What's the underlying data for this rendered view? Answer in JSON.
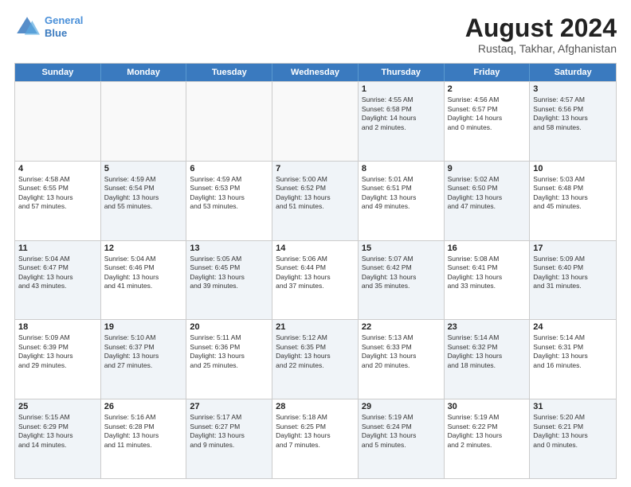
{
  "logo": {
    "line1": "General",
    "line2": "Blue"
  },
  "header": {
    "month_year": "August 2024",
    "location": "Rustaq, Takhar, Afghanistan"
  },
  "weekdays": [
    "Sunday",
    "Monday",
    "Tuesday",
    "Wednesday",
    "Thursday",
    "Friday",
    "Saturday"
  ],
  "weeks": [
    [
      {
        "day": "",
        "info": "",
        "empty": true
      },
      {
        "day": "",
        "info": "",
        "empty": true
      },
      {
        "day": "",
        "info": "",
        "empty": true
      },
      {
        "day": "",
        "info": "",
        "empty": true
      },
      {
        "day": "1",
        "info": "Sunrise: 4:55 AM\nSunset: 6:58 PM\nDaylight: 14 hours\nand 2 minutes.",
        "empty": false
      },
      {
        "day": "2",
        "info": "Sunrise: 4:56 AM\nSunset: 6:57 PM\nDaylight: 14 hours\nand 0 minutes.",
        "empty": false
      },
      {
        "day": "3",
        "info": "Sunrise: 4:57 AM\nSunset: 6:56 PM\nDaylight: 13 hours\nand 58 minutes.",
        "empty": false
      }
    ],
    [
      {
        "day": "4",
        "info": "Sunrise: 4:58 AM\nSunset: 6:55 PM\nDaylight: 13 hours\nand 57 minutes.",
        "empty": false
      },
      {
        "day": "5",
        "info": "Sunrise: 4:59 AM\nSunset: 6:54 PM\nDaylight: 13 hours\nand 55 minutes.",
        "empty": false
      },
      {
        "day": "6",
        "info": "Sunrise: 4:59 AM\nSunset: 6:53 PM\nDaylight: 13 hours\nand 53 minutes.",
        "empty": false
      },
      {
        "day": "7",
        "info": "Sunrise: 5:00 AM\nSunset: 6:52 PM\nDaylight: 13 hours\nand 51 minutes.",
        "empty": false
      },
      {
        "day": "8",
        "info": "Sunrise: 5:01 AM\nSunset: 6:51 PM\nDaylight: 13 hours\nand 49 minutes.",
        "empty": false
      },
      {
        "day": "9",
        "info": "Sunrise: 5:02 AM\nSunset: 6:50 PM\nDaylight: 13 hours\nand 47 minutes.",
        "empty": false
      },
      {
        "day": "10",
        "info": "Sunrise: 5:03 AM\nSunset: 6:48 PM\nDaylight: 13 hours\nand 45 minutes.",
        "empty": false
      }
    ],
    [
      {
        "day": "11",
        "info": "Sunrise: 5:04 AM\nSunset: 6:47 PM\nDaylight: 13 hours\nand 43 minutes.",
        "empty": false
      },
      {
        "day": "12",
        "info": "Sunrise: 5:04 AM\nSunset: 6:46 PM\nDaylight: 13 hours\nand 41 minutes.",
        "empty": false
      },
      {
        "day": "13",
        "info": "Sunrise: 5:05 AM\nSunset: 6:45 PM\nDaylight: 13 hours\nand 39 minutes.",
        "empty": false
      },
      {
        "day": "14",
        "info": "Sunrise: 5:06 AM\nSunset: 6:44 PM\nDaylight: 13 hours\nand 37 minutes.",
        "empty": false
      },
      {
        "day": "15",
        "info": "Sunrise: 5:07 AM\nSunset: 6:42 PM\nDaylight: 13 hours\nand 35 minutes.",
        "empty": false
      },
      {
        "day": "16",
        "info": "Sunrise: 5:08 AM\nSunset: 6:41 PM\nDaylight: 13 hours\nand 33 minutes.",
        "empty": false
      },
      {
        "day": "17",
        "info": "Sunrise: 5:09 AM\nSunset: 6:40 PM\nDaylight: 13 hours\nand 31 minutes.",
        "empty": false
      }
    ],
    [
      {
        "day": "18",
        "info": "Sunrise: 5:09 AM\nSunset: 6:39 PM\nDaylight: 13 hours\nand 29 minutes.",
        "empty": false
      },
      {
        "day": "19",
        "info": "Sunrise: 5:10 AM\nSunset: 6:37 PM\nDaylight: 13 hours\nand 27 minutes.",
        "empty": false
      },
      {
        "day": "20",
        "info": "Sunrise: 5:11 AM\nSunset: 6:36 PM\nDaylight: 13 hours\nand 25 minutes.",
        "empty": false
      },
      {
        "day": "21",
        "info": "Sunrise: 5:12 AM\nSunset: 6:35 PM\nDaylight: 13 hours\nand 22 minutes.",
        "empty": false
      },
      {
        "day": "22",
        "info": "Sunrise: 5:13 AM\nSunset: 6:33 PM\nDaylight: 13 hours\nand 20 minutes.",
        "empty": false
      },
      {
        "day": "23",
        "info": "Sunrise: 5:14 AM\nSunset: 6:32 PM\nDaylight: 13 hours\nand 18 minutes.",
        "empty": false
      },
      {
        "day": "24",
        "info": "Sunrise: 5:14 AM\nSunset: 6:31 PM\nDaylight: 13 hours\nand 16 minutes.",
        "empty": false
      }
    ],
    [
      {
        "day": "25",
        "info": "Sunrise: 5:15 AM\nSunset: 6:29 PM\nDaylight: 13 hours\nand 14 minutes.",
        "empty": false
      },
      {
        "day": "26",
        "info": "Sunrise: 5:16 AM\nSunset: 6:28 PM\nDaylight: 13 hours\nand 11 minutes.",
        "empty": false
      },
      {
        "day": "27",
        "info": "Sunrise: 5:17 AM\nSunset: 6:27 PM\nDaylight: 13 hours\nand 9 minutes.",
        "empty": false
      },
      {
        "day": "28",
        "info": "Sunrise: 5:18 AM\nSunset: 6:25 PM\nDaylight: 13 hours\nand 7 minutes.",
        "empty": false
      },
      {
        "day": "29",
        "info": "Sunrise: 5:19 AM\nSunset: 6:24 PM\nDaylight: 13 hours\nand 5 minutes.",
        "empty": false
      },
      {
        "day": "30",
        "info": "Sunrise: 5:19 AM\nSunset: 6:22 PM\nDaylight: 13 hours\nand 2 minutes.",
        "empty": false
      },
      {
        "day": "31",
        "info": "Sunrise: 5:20 AM\nSunset: 6:21 PM\nDaylight: 13 hours\nand 0 minutes.",
        "empty": false
      }
    ]
  ]
}
